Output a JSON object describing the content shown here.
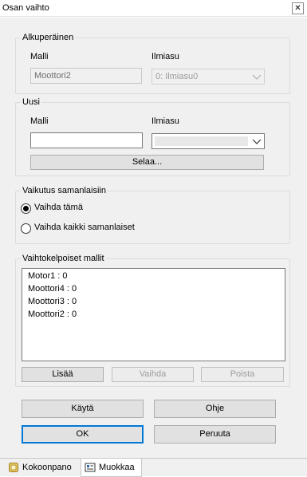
{
  "window": {
    "title": "Osan vaihto",
    "close_glyph": "✕"
  },
  "original": {
    "legend": "Alkuperäinen",
    "model_label": "Malli",
    "model_value": "Moottori2",
    "display_label": "Ilmiasu",
    "display_value": "0: Ilmiasu0"
  },
  "new": {
    "legend": "Uusi",
    "model_label": "Malli",
    "model_value": "",
    "display_label": "Ilmiasu",
    "display_value": "",
    "browse_label": "Selaa..."
  },
  "effect": {
    "legend": "Vaikutus samanlaisiin",
    "options": [
      {
        "label": "Vaihda tämä",
        "selected": true
      },
      {
        "label": "Vaihda kaikki samanlaiset",
        "selected": false
      }
    ]
  },
  "alternatives": {
    "legend": "Vaihtokelpoiset mallit",
    "items": [
      "Motor1 : 0",
      "Moottori4 : 0",
      "Moottori3 : 0",
      "Moottori2 : 0"
    ],
    "add_label": "Lisää",
    "replace_label": "Vaihda",
    "remove_label": "Poista"
  },
  "actions": {
    "apply_label": "Käytä",
    "help_label": "Ohje",
    "ok_label": "OK",
    "cancel_label": "Peruuta"
  },
  "tabs": [
    {
      "label": "Kokoonpano",
      "icon": "assembly-icon",
      "active": false
    },
    {
      "label": "Muokkaa",
      "icon": "edit-icon",
      "active": true
    }
  ],
  "colors": {
    "focus_blue": "#0078d7",
    "dialog_bg": "#f0f0f0"
  }
}
